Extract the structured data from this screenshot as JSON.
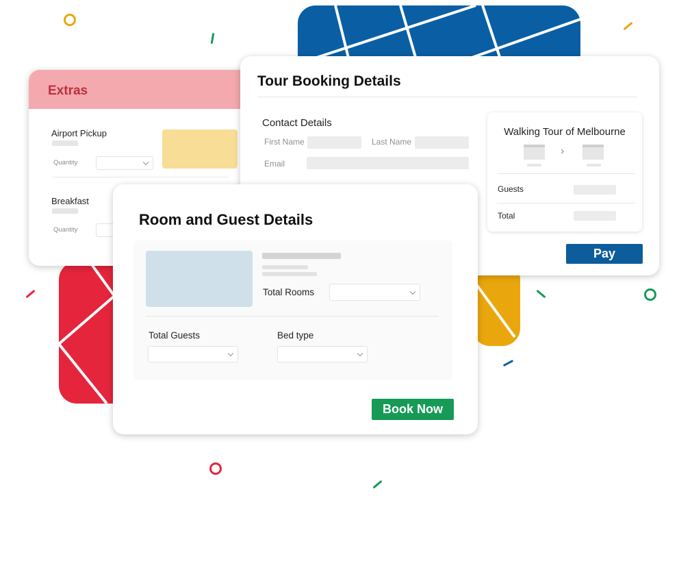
{
  "colors": {
    "blue": "#0a5fa4",
    "red": "#e5253c",
    "yellow": "#eaa70d",
    "green": "#169a56",
    "pink_header": "#f4a9ae",
    "extras_title": "#b9323f",
    "pay_button": "#0d5c9b"
  },
  "extras": {
    "title": "Extras",
    "items": [
      {
        "label": "Airport Pickup",
        "quantity_label": "Quantity"
      },
      {
        "label": "Breakfast",
        "quantity_label": "Quantity"
      }
    ]
  },
  "tour": {
    "title": "Tour Booking Details",
    "contact": {
      "heading": "Contact Details",
      "first_name_label": "First Name",
      "last_name_label": "Last Name",
      "email_label": "Email"
    },
    "summary": {
      "title": "Walking Tour of Melbourne",
      "arrow": "›",
      "guests_label": "Guests",
      "total_label": "Total"
    },
    "pay_label": "Pay"
  },
  "room": {
    "title": "Room and Guest Details",
    "total_rooms_label": "Total Rooms",
    "total_guests_label": "Total Guests",
    "bed_type_label": "Bed type",
    "book_label": "Book Now"
  }
}
